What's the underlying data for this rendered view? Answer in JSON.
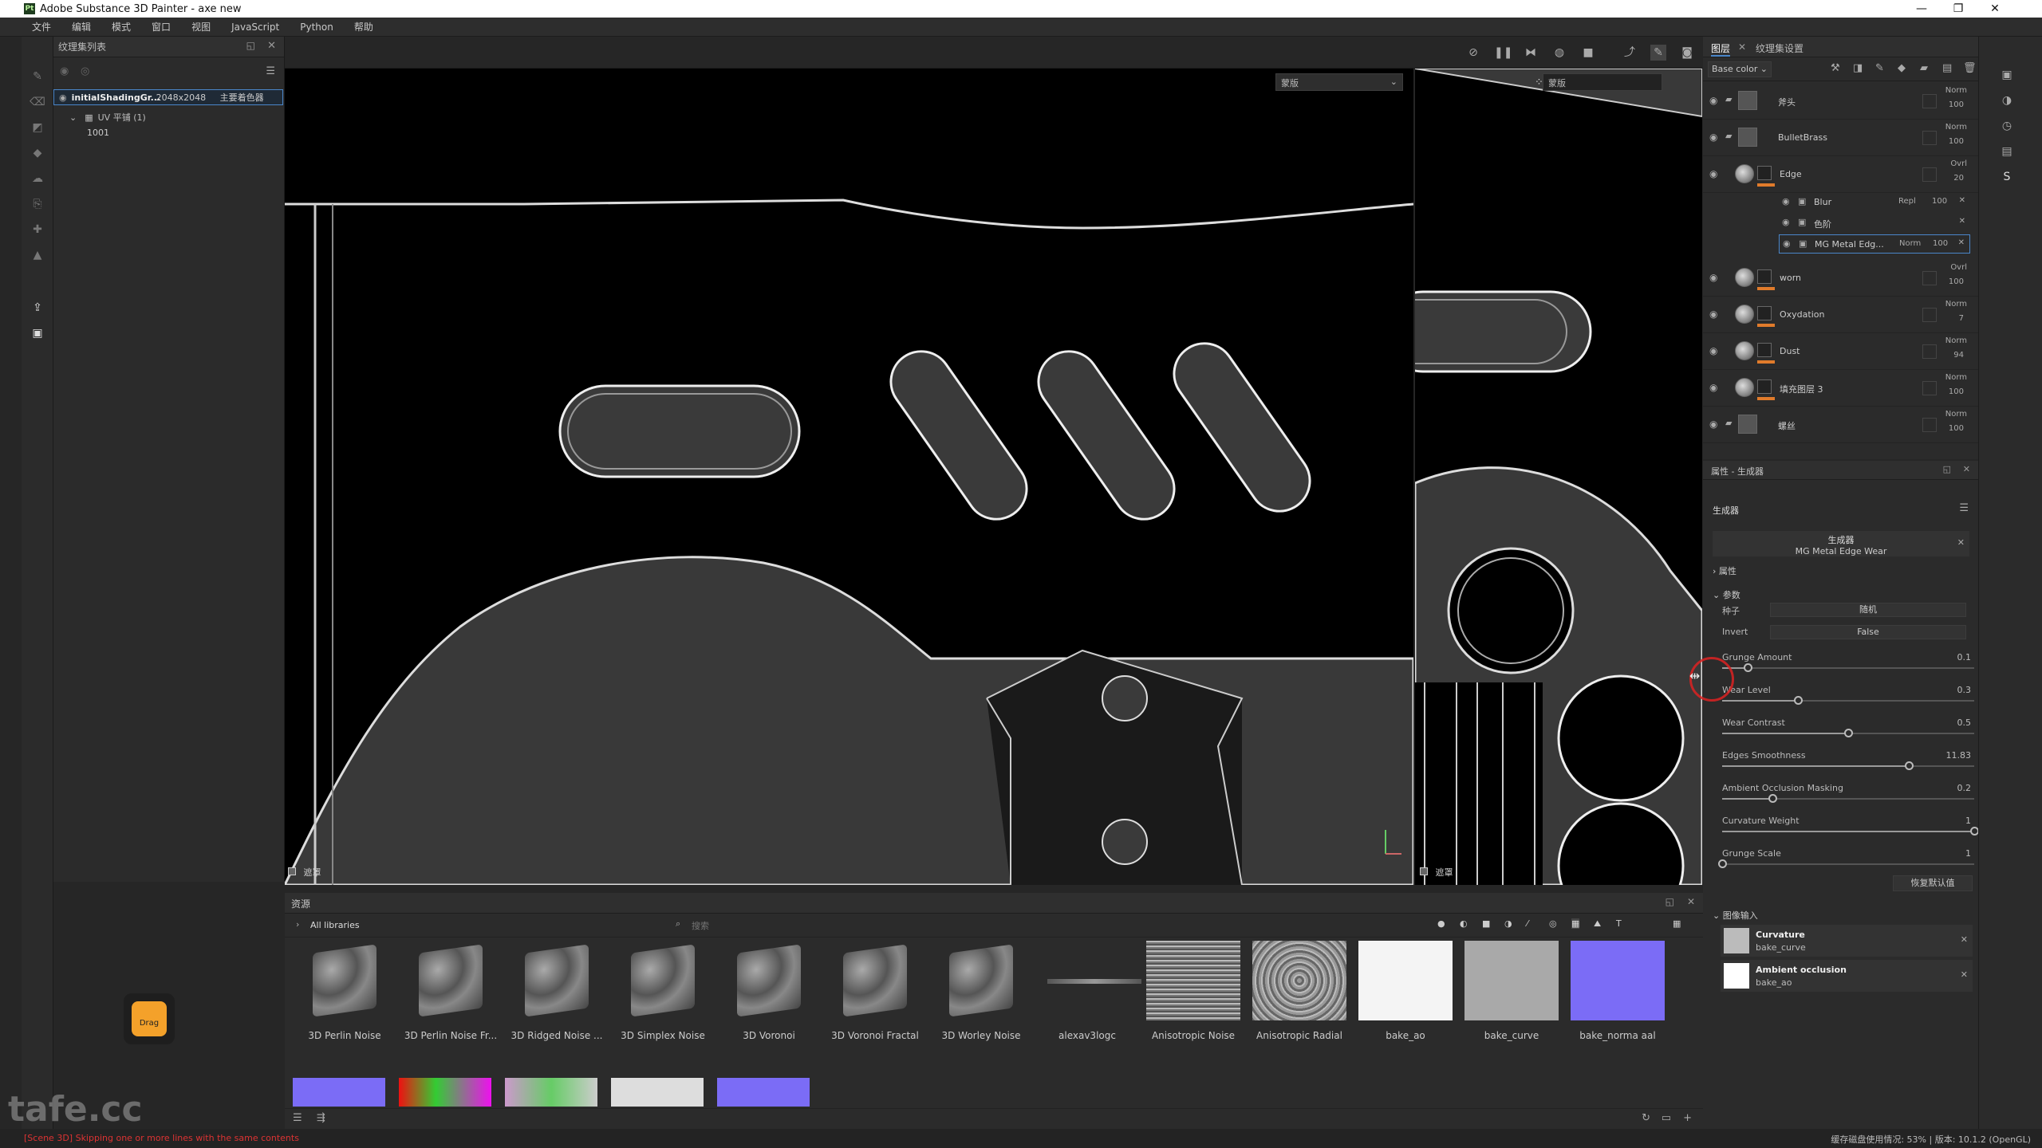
{
  "window": {
    "title": "Adobe Substance 3D Painter - axe new",
    "logo_text": "Pt",
    "minimize": "—",
    "maximize": "❐",
    "close": "✕"
  },
  "menu": [
    "文件",
    "编辑",
    "模式",
    "窗口",
    "视图",
    "JavaScript",
    "Python",
    "帮助"
  ],
  "texture_set_panel": {
    "title": "纹理集列表",
    "item_name": "initialShadingGr...",
    "item_size": "2048x2048",
    "item_shader": "主要着色器",
    "uv_label": "UV 平铺 (1)",
    "tile": "1001"
  },
  "viewport": {
    "left_dropdown": "蒙版",
    "right_dropdown": "蒙版",
    "left_label": "遮罩",
    "right_label": "遮罩"
  },
  "layers_panel": {
    "tab1": "图层",
    "tab2": "纹理集设置",
    "channel": "Base color",
    "layers": [
      {
        "name": "斧头",
        "blend": "Norm",
        "opacity": "100",
        "type": "folder"
      },
      {
        "name": "BulletBrass",
        "blend": "Norm",
        "opacity": "100",
        "type": "folder"
      },
      {
        "name": "Edge",
        "blend": "Ovrl",
        "opacity": "20",
        "type": "fill"
      },
      {
        "name": "worn",
        "blend": "Ovrl",
        "opacity": "100",
        "type": "fill"
      },
      {
        "name": "Oxydation",
        "blend": "Norm",
        "opacity": "7",
        "type": "fill"
      },
      {
        "name": "Dust",
        "blend": "Norm",
        "opacity": "94",
        "type": "fill"
      },
      {
        "name": "填充图层 3",
        "blend": "Norm",
        "opacity": "100",
        "type": "fill"
      },
      {
        "name": "螺丝",
        "blend": "Norm",
        "opacity": "100",
        "type": "folder"
      }
    ],
    "sublayers": [
      {
        "name": "Blur",
        "blend": "Repl",
        "opacity": "100"
      },
      {
        "name": "色阶",
        "blend": "",
        "opacity": ""
      },
      {
        "name": "MG Metal Edg...",
        "blend": "Norm",
        "opacity": "100"
      }
    ]
  },
  "properties": {
    "title": "属性 - 生成器",
    "section": "生成器",
    "gen_title": "生成器",
    "gen_name": "MG Metal Edge Wear",
    "attr": "属性",
    "params": "参数",
    "seed_label": "种子",
    "seed_value": "随机",
    "invert_label": "Invert",
    "invert_value": "False",
    "sliders": [
      {
        "label": "Grunge Amount",
        "value": "0.1",
        "frac": 0.1
      },
      {
        "label": "Wear Level",
        "value": "0.3",
        "frac": 0.3
      },
      {
        "label": "Wear Contrast",
        "value": "0.5",
        "frac": 0.5
      },
      {
        "label": "Edges Smoothness",
        "value": "11.83",
        "frac": 0.74
      },
      {
        "label": "Ambient Occlusion Masking",
        "value": "0.2",
        "frac": 0.2
      },
      {
        "label": "Curvature Weight",
        "value": "1",
        "frac": 1.0
      },
      {
        "label": "Grunge Scale",
        "value": "1",
        "frac": 0.0
      }
    ],
    "reset": "恢复默认值",
    "img_inputs_title": "图像输入",
    "inputs": [
      {
        "name": "Curvature",
        "map": "bake_curve"
      },
      {
        "name": "Ambient occlusion",
        "map": "bake_ao"
      }
    ]
  },
  "assets": {
    "title": "资源",
    "library": "All libraries",
    "search_placeholder": "搜索",
    "items": [
      "3D Perlin Noise",
      "3D Perlin Noise Fr...",
      "3D Ridged Noise ...",
      "3D Simplex Noise",
      "3D Voronoi",
      "3D Voronoi Fractal",
      "3D Worley Noise",
      "alexav3logc",
      "Anisotropic Noise",
      "Anisotropic Radial",
      "bake_ao",
      "bake_curve",
      "bake_norma aal"
    ]
  },
  "drag_label": "Drag",
  "status": {
    "left": "[Scene 3D] Skipping one or more lines with the same contents",
    "right": "缓存磁盘使用情况:    53% | 版本: 10.1.2 (OpenGL)"
  },
  "watermark": "tafe.cc"
}
